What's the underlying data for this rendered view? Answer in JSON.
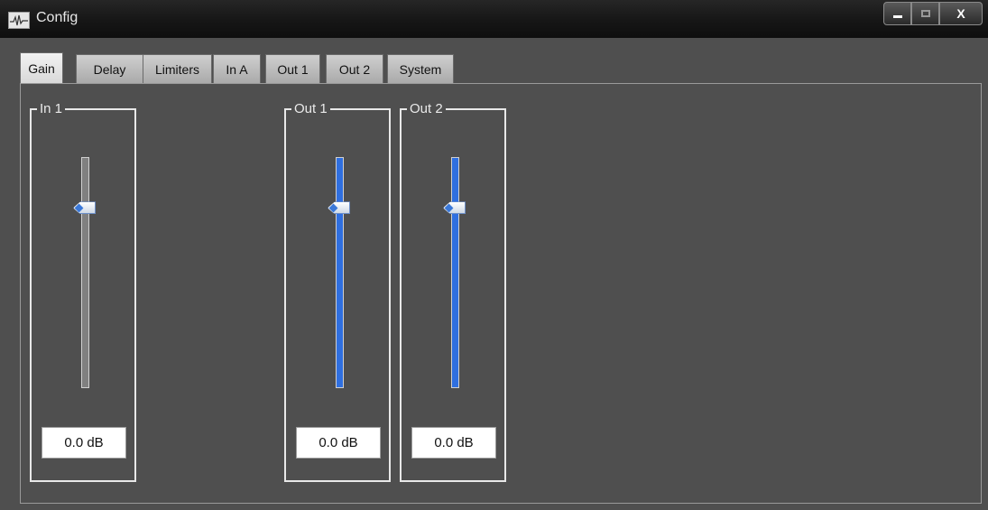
{
  "window": {
    "title": "Config",
    "close_label": "X"
  },
  "tabs": [
    {
      "label": "Gain",
      "active": true
    },
    {
      "label": "Delay",
      "active": false
    },
    {
      "label": "Limiters",
      "active": false
    },
    {
      "label": "In A",
      "active": false
    },
    {
      "label": "Out 1",
      "active": false
    },
    {
      "label": "Out 2",
      "active": false
    },
    {
      "label": "System",
      "active": false
    }
  ],
  "channels": [
    {
      "label": "In 1",
      "value": "0.0 dB",
      "level": 0.78,
      "fill_color": "#808080"
    },
    {
      "label": "Out 1",
      "value": "0.0 dB",
      "level": 0.78,
      "fill_color": "#2f6fe0"
    },
    {
      "label": "Out 2",
      "value": "0.0 dB",
      "level": 0.78,
      "fill_color": "#2f6fe0"
    }
  ]
}
